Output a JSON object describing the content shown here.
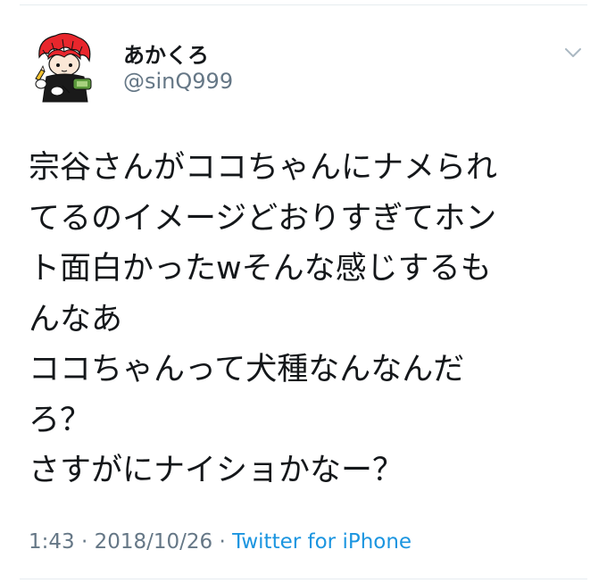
{
  "tweet": {
    "author": {
      "display_name": "あかくろ",
      "handle": "@sinQ999",
      "avatar_icon": "avatar-illustration"
    },
    "menu_icon": "chevron-down-icon",
    "lines": [
      "宗谷さんがココちゃんにナメられ",
      "てるのイメージどおりすぎてホン",
      "ト面白かったwそんな感じするも",
      "んなあ",
      "ココちゃんって犬種なんなんだ",
      "ろ？",
      "さすがにナイショかなー？"
    ],
    "time": "1:43",
    "separator": " · ",
    "date": "2018/10/26",
    "source": "Twitter for iPhone"
  },
  "colors": {
    "text": "#14171a",
    "secondary": "#657786",
    "link": "#1b95e0",
    "divider": "#e6ecf0"
  }
}
